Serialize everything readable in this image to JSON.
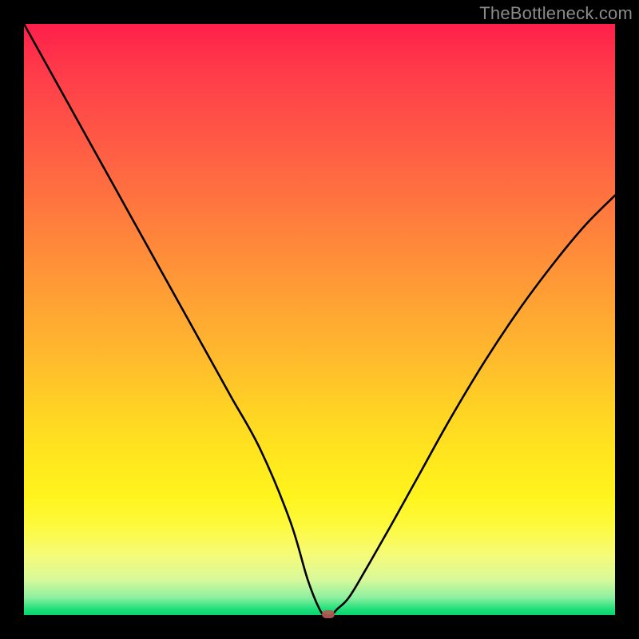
{
  "watermark": "TheBottleneck.com",
  "chart_data": {
    "type": "line",
    "title": "",
    "xlabel": "",
    "ylabel": "",
    "xlim": [
      0,
      100
    ],
    "ylim": [
      0,
      100
    ],
    "grid": false,
    "legend": false,
    "background_gradient": {
      "direction": "top-to-bottom",
      "stops": [
        {
          "pos": 0,
          "color": "#ff1f4b"
        },
        {
          "pos": 20,
          "color": "#ff5a45"
        },
        {
          "pos": 44,
          "color": "#ff9a36"
        },
        {
          "pos": 66,
          "color": "#ffd523"
        },
        {
          "pos": 85,
          "color": "#fdfa3e"
        },
        {
          "pos": 97,
          "color": "#8ef0a0"
        },
        {
          "pos": 100,
          "color": "#06d46e"
        }
      ]
    },
    "series": [
      {
        "name": "bottleneck-curve",
        "color": "#000000",
        "x": [
          0,
          5,
          10,
          15,
          20,
          25,
          30,
          35,
          40,
          45,
          48,
          50,
          51,
          52,
          53,
          55,
          58,
          62,
          67,
          72,
          78,
          84,
          90,
          95,
          100
        ],
        "y": [
          100,
          91,
          82,
          73,
          64,
          55,
          46,
          37,
          28,
          16,
          6,
          1,
          0,
          0,
          1,
          3,
          8,
          15,
          24,
          33,
          43,
          52,
          60,
          66,
          71
        ]
      }
    ],
    "min_marker": {
      "x": 51.5,
      "y": 0,
      "color": "#b35a52"
    }
  }
}
